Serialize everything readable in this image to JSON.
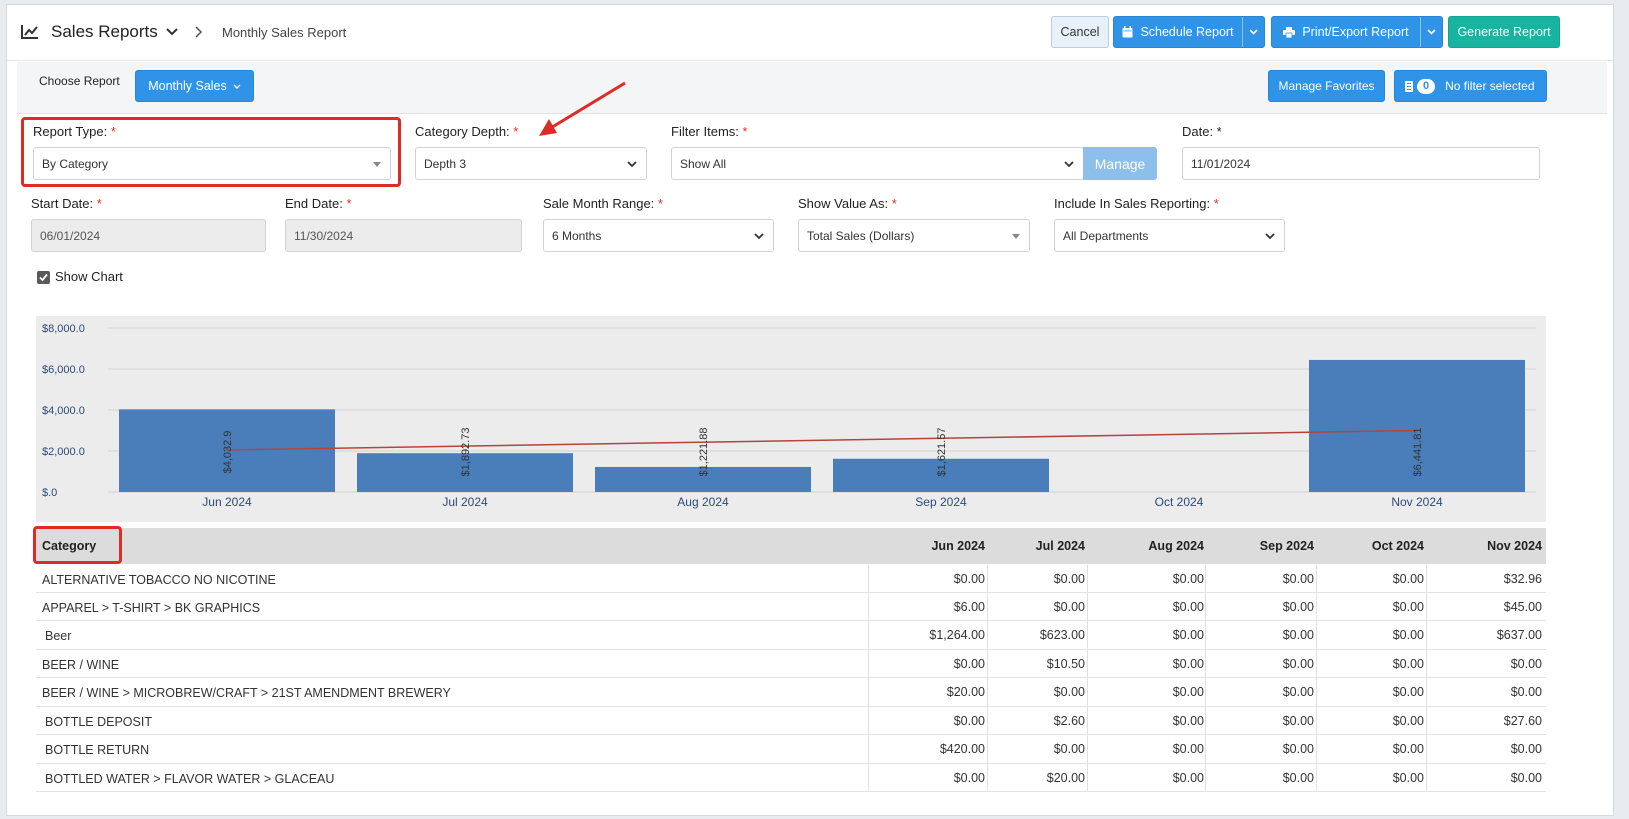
{
  "header": {
    "title": "Sales Reports",
    "breadcrumb": "Monthly Sales Report",
    "cancel_label": "Cancel",
    "schedule_label": "Schedule Report",
    "print_label": "Print/Export Report",
    "generate_label": "Generate Report"
  },
  "subbar": {
    "choose_label": "Choose Report",
    "report_select": "Monthly Sales",
    "manage_favorites": "Manage Favorites",
    "filter_count": "0",
    "filter_label": "No filter selected"
  },
  "form": {
    "report_type_label": "Report Type:",
    "report_type_value": "By Category",
    "category_depth_label": "Category Depth:",
    "category_depth_value": "Depth 3",
    "filter_items_label": "Filter Items:",
    "filter_items_value": "Show All",
    "manage_label": "Manage",
    "date_label": "Date: *",
    "date_value": "11/01/2024",
    "start_date_label": "Start Date:",
    "start_date_value": "06/01/2024",
    "end_date_label": "End Date:",
    "end_date_value": "11/30/2024",
    "sale_month_range_label": "Sale Month Range:",
    "sale_month_range_value": "6 Months",
    "show_value_as_label": "Show Value As:",
    "show_value_as_value": "Total Sales (Dollars)",
    "include_label": "Include In Sales Reporting:",
    "include_value": "All Departments",
    "required_mark": "*",
    "show_chart_label": "Show Chart",
    "show_chart_checked": true
  },
  "chart_data": {
    "type": "bar",
    "categories": [
      "Jun 2024",
      "Jul 2024",
      "Aug 2024",
      "Sep 2024",
      "Oct 2024",
      "Nov 2024"
    ],
    "values": [
      4032.9,
      1892.73,
      1221.88,
      1621.57,
      0,
      6441.81
    ],
    "data_labels": [
      "$4,032.9",
      "$1,892.73",
      "$1,221.88",
      "$1,621.57",
      "",
      "$6,441.81"
    ],
    "y_ticks": [
      "$8,000.0",
      "$6,000.0",
      "$4,000.0",
      "$2,000.0",
      "$.0"
    ],
    "ylim": [
      0,
      8000
    ],
    "trendline": {
      "start": 2050,
      "end": 3000
    },
    "bar_color": "#4a7ebb",
    "trend_color": "#b5443b",
    "grid": true
  },
  "table": {
    "category_header": "Category",
    "months": [
      "Jun 2024",
      "Jul 2024",
      "Aug 2024",
      "Sep 2024",
      "Oct 2024",
      "Nov 2024"
    ],
    "rows": [
      {
        "name": "ALTERNATIVE TOBACCO NO NICOTINE",
        "values": [
          "$0.00",
          "$0.00",
          "$0.00",
          "$0.00",
          "$0.00",
          "$32.96"
        ]
      },
      {
        "name": "APPAREL > T-SHIRT > BK GRAPHICS",
        "values": [
          "$6.00",
          "$0.00",
          "$0.00",
          "$0.00",
          "$0.00",
          "$45.00"
        ]
      },
      {
        "name": "Beer",
        "values": [
          "$1,264.00",
          "$623.00",
          "$0.00",
          "$0.00",
          "$0.00",
          "$637.00"
        ]
      },
      {
        "name": "BEER / WINE",
        "values": [
          "$0.00",
          "$10.50",
          "$0.00",
          "$0.00",
          "$0.00",
          "$0.00"
        ]
      },
      {
        "name": "BEER / WINE > MICROBREW/CRAFT > 21ST AMENDMENT BREWERY",
        "values": [
          "$20.00",
          "$0.00",
          "$0.00",
          "$0.00",
          "$0.00",
          "$0.00"
        ]
      },
      {
        "name": "BOTTLE DEPOSIT",
        "values": [
          "$0.00",
          "$2.60",
          "$0.00",
          "$0.00",
          "$0.00",
          "$27.60"
        ]
      },
      {
        "name": "BOTTLE RETURN",
        "values": [
          "$420.00",
          "$0.00",
          "$0.00",
          "$0.00",
          "$0.00",
          "$0.00"
        ]
      },
      {
        "name": "BOTTLED WATER > FLAVOR WATER > GLACEAU",
        "values": [
          "$0.00",
          "$20.00",
          "$0.00",
          "$0.00",
          "$0.00",
          "$0.00"
        ]
      }
    ]
  },
  "colors": {
    "primary_blue": "#2f94e8",
    "teal": "#19b4a0",
    "highlight_red": "#dd2b26"
  }
}
